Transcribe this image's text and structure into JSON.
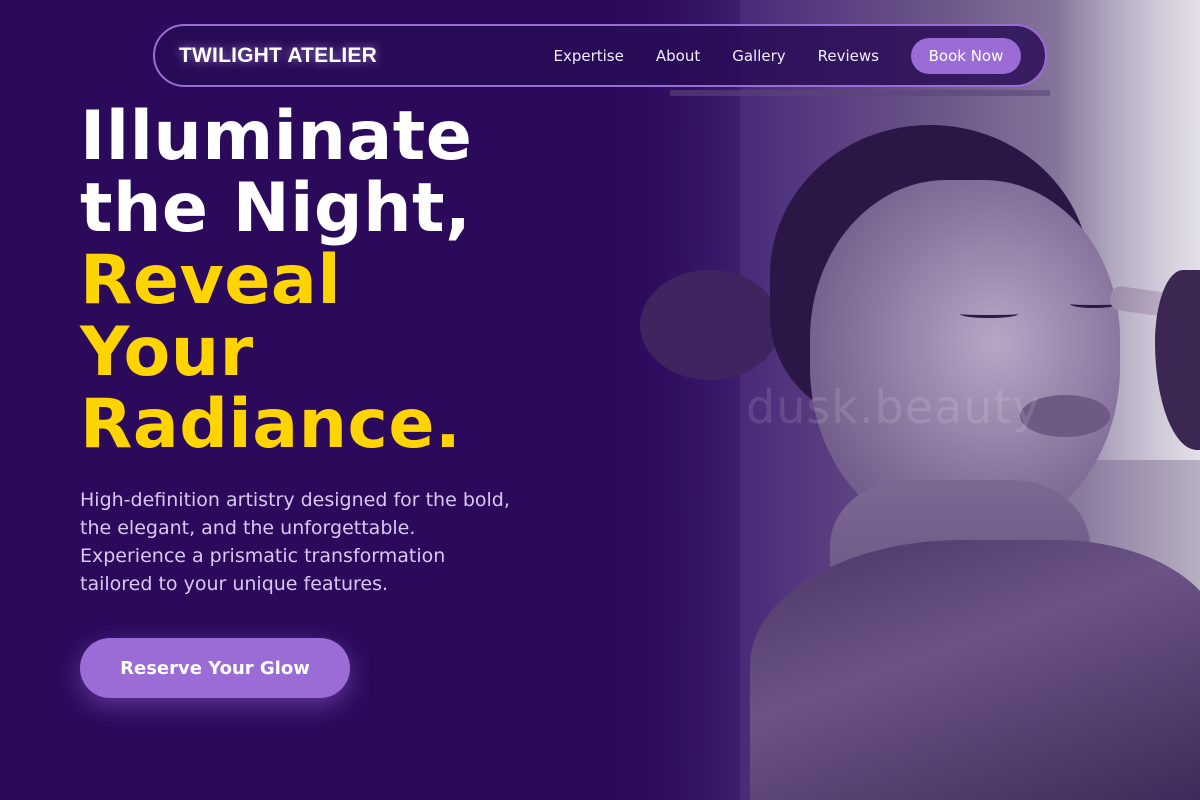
{
  "brand": "TWILIGHT ATELIER",
  "nav": {
    "links": [
      "Expertise",
      "About",
      "Gallery",
      "Reviews"
    ],
    "cta": "Book Now"
  },
  "hero": {
    "headline_white": [
      "Illuminate",
      "the Night,"
    ],
    "headline_yellow": [
      "Reveal",
      "Your",
      "Radiance."
    ],
    "subtext": "High-definition artistry designed for the bold, the elegant, and the unforgettable. Experience a prismatic transformation tailored to your unique features.",
    "cta": "Reserve Your Glow"
  },
  "photo": {
    "watermark": "dusk.beauty"
  },
  "colors": {
    "background": "#2b0a5c",
    "accent": "#9b6bd6",
    "highlight": "#ffd400"
  }
}
